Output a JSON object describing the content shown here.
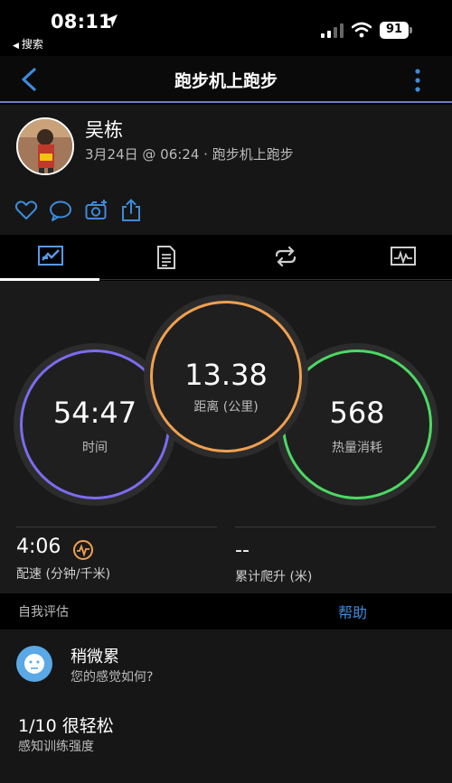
{
  "status": {
    "time": "08:11",
    "back_app": "搜索",
    "battery": "91"
  },
  "navbar": {
    "title": "跑步机上跑步"
  },
  "header": {
    "user_name": "吴栋",
    "subtitle": "3月24日 @ 06:24 · 跑步机上跑步"
  },
  "stats": {
    "time": {
      "value": "54:47",
      "label": "时间",
      "color": "#7b6cf0"
    },
    "distance": {
      "value": "13.38",
      "label": "距离 (公里)",
      "color": "#f0a050"
    },
    "calories": {
      "value": "568",
      "label": "热量消耗",
      "color": "#4cd964"
    },
    "pace": {
      "value": "4:06",
      "label": "配速 (分钟/千米)"
    },
    "ascent": {
      "value": "--",
      "label": "累计爬升 (米)"
    }
  },
  "evaluation": {
    "section_title": "自我评估",
    "help": "帮助",
    "feel_title": "稍微累",
    "feel_sub": "您的感觉如何?",
    "intensity": "1/10 很轻松",
    "intensity_label": "感知训练强度"
  },
  "colors": {
    "accent_blue": "#3d8bdb",
    "pace_icon": "#f0a050"
  }
}
